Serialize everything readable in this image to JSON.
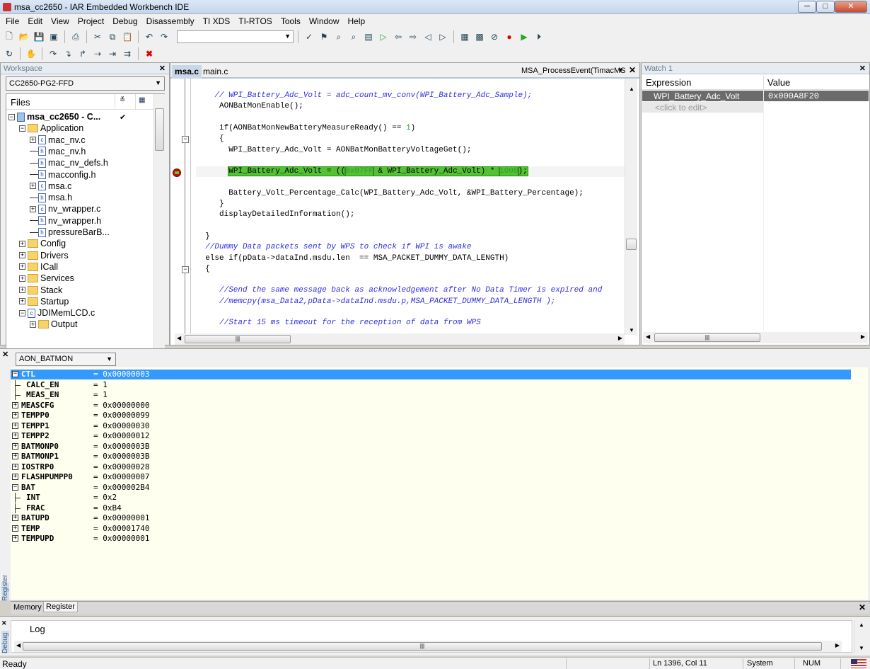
{
  "window": {
    "title": "msa_cc2650 - IAR Embedded Workbench IDE",
    "minimize": "─",
    "maximize": "□",
    "close": "✕"
  },
  "menu": [
    "File",
    "Edit",
    "View",
    "Project",
    "Debug",
    "Disassembly",
    "TI XDS",
    "TI-RTOS",
    "Tools",
    "Window",
    "Help"
  ],
  "toolbar1": {
    "icons": [
      "new-file-icon",
      "open-icon",
      "save-icon",
      "save-all-icon",
      "print-icon",
      "cut-icon",
      "copy-icon",
      "paste-icon",
      "undo-icon",
      "redo-icon"
    ],
    "search_value": "",
    "icons_right": [
      "check-icon",
      "bookmark-icon",
      "find-icon",
      "find-in-files-icon",
      "goto-icon",
      "next-bookmark-icon",
      "prev-icon",
      "next-icon",
      "nav-back-icon",
      "nav-forward-icon",
      "compile-icon",
      "make-icon",
      "stop-build-icon",
      "breakpoint-icon",
      "debug-icon",
      "download-debug-icon"
    ]
  },
  "toolbar2": {
    "icons": [
      "reset-icon",
      "break-icon",
      "step-over-icon",
      "step-into-icon",
      "step-out-icon",
      "next-statement-icon",
      "run-to-cursor-icon",
      "go-icon",
      "stop-debug-icon"
    ]
  },
  "workspace": {
    "title": "Workspace",
    "config": "CC2650-PG2-FFD",
    "files_header": "Files",
    "tree": [
      {
        "label": "msa_cc2650 - C...",
        "depth": 0,
        "type": "project",
        "exp": "-",
        "bold": true,
        "check": "✔"
      },
      {
        "label": "Application",
        "depth": 1,
        "type": "folder",
        "exp": "-"
      },
      {
        "label": "mac_nv.c",
        "depth": 2,
        "type": "c",
        "exp": "+"
      },
      {
        "label": "mac_nv.h",
        "depth": 2,
        "type": "h"
      },
      {
        "label": "mac_nv_defs.h",
        "depth": 2,
        "type": "h"
      },
      {
        "label": "macconfig.h",
        "depth": 2,
        "type": "h"
      },
      {
        "label": "msa.c",
        "depth": 2,
        "type": "c",
        "exp": "+"
      },
      {
        "label": "msa.h",
        "depth": 2,
        "type": "h"
      },
      {
        "label": "nv_wrapper.c",
        "depth": 2,
        "type": "c",
        "exp": "+"
      },
      {
        "label": "nv_wrapper.h",
        "depth": 2,
        "type": "h"
      },
      {
        "label": "pressureBarB...",
        "depth": 2,
        "type": "h"
      },
      {
        "label": "Config",
        "depth": 1,
        "type": "folder",
        "exp": "+"
      },
      {
        "label": "Drivers",
        "depth": 1,
        "type": "folder",
        "exp": "+"
      },
      {
        "label": "ICall",
        "depth": 1,
        "type": "folder",
        "exp": "+"
      },
      {
        "label": "Services",
        "depth": 1,
        "type": "folder",
        "exp": "+"
      },
      {
        "label": "Stack",
        "depth": 1,
        "type": "folder",
        "exp": "+"
      },
      {
        "label": "Startup",
        "depth": 1,
        "type": "folder",
        "exp": "+"
      },
      {
        "label": "JDIMemLCD.c",
        "depth": 1,
        "type": "c",
        "exp": "-"
      },
      {
        "label": "Output",
        "depth": 2,
        "type": "folder",
        "exp": "+"
      }
    ],
    "tabs": [
      "Overview",
      "msa_cc2650",
      "cc2650Stack"
    ]
  },
  "editor": {
    "tabs": [
      "msa.c",
      "main.c"
    ],
    "active_tab": "msa.c",
    "function_nav": "MSA_ProcessEvent(TimacMS",
    "lines": [
      [
        {
          "t": "    // WPI_Battery_Adc_Volt = adc_count_mv_conv(WPI_Battery_Adc_Sample);",
          "k": "cm"
        }
      ],
      [
        {
          "t": "     AONBatMonEnable();"
        }
      ],
      [],
      [
        {
          "t": "     if(AONBatMonNewBatteryMeasureReady() == "
        },
        {
          "t": "1",
          "k": "num"
        },
        {
          "t": ")"
        }
      ],
      [
        {
          "t": "     {"
        }
      ],
      [
        {
          "t": "       WPI_Battery_Adc_Volt = AONBatMonBatteryVoltageGet();"
        }
      ],
      [],
      [
        {
          "t": "       "
        },
        {
          "t": "WPI_Battery_Adc_Volt = ((",
          "k": "hl"
        },
        {
          "t": "0x07FF",
          "k": "hl num"
        },
        {
          "t": " & WPI_Battery_Adc_Volt) * ",
          "k": "hl"
        },
        {
          "t": "1000",
          "k": "hl num"
        },
        {
          "t": ");",
          "k": "hl"
        }
      ],
      [],
      [
        {
          "t": "       Battery_Volt_Percentage_Calc(WPI_Battery_Adc_Volt, &WPI_Battery_Percentage);"
        }
      ],
      [
        {
          "t": "     }"
        }
      ],
      [
        {
          "t": "     displayDetailedInformation();"
        }
      ],
      [],
      [
        {
          "t": "  }"
        }
      ],
      [
        {
          "t": "  //Dummy Data packets sent by WPS to check if WPI is awake",
          "k": "cm"
        }
      ],
      [
        {
          "t": "  else if(pData->dataInd.msdu.len  == MSA_PACKET_DUMMY_DATA_LENGTH)"
        }
      ],
      [
        {
          "t": "  {"
        }
      ],
      [],
      [
        {
          "t": "     //Send the same message back as acknowledgement after No Data Timer is expired and",
          "k": "cm"
        }
      ],
      [
        {
          "t": "     //memcpy(msa_Data2,pData->dataInd.msdu.p,MSA_PACKET_DUMMY_DATA_LENGTH );",
          "k": "cm"
        }
      ],
      [],
      [
        {
          "t": "     //Start 15 ms timeout for the reception of data from WPS",
          "k": "cm"
        }
      ]
    ]
  },
  "watch": {
    "title": "Watch 1",
    "col_expression": "Expression",
    "col_value": "Value",
    "rows": [
      {
        "expression": "WPI_Battery_Adc_Volt",
        "value": "0x000A8F20"
      }
    ],
    "placeholder": "<click to edit>"
  },
  "register": {
    "side_label": "Register",
    "group": "AON_BATMON",
    "rows": [
      {
        "name": "CTL",
        "value": "= 0x00000003",
        "exp": "-",
        "selected": true
      },
      {
        "name": "CALC_EN",
        "value": "= 1",
        "child": true
      },
      {
        "name": "MEAS_EN",
        "value": "= 1",
        "child": true
      },
      {
        "name": "MEASCFG",
        "value": "= 0x00000000",
        "exp": "+"
      },
      {
        "name": "TEMPP0",
        "value": "= 0x00000099",
        "exp": "+"
      },
      {
        "name": "TEMPP1",
        "value": "= 0x00000030",
        "exp": "+"
      },
      {
        "name": "TEMPP2",
        "value": "= 0x00000012",
        "exp": "+"
      },
      {
        "name": "BATMONP0",
        "value": "= 0x0000003B",
        "exp": "+"
      },
      {
        "name": "BATMONP1",
        "value": "= 0x0000003B",
        "exp": "+"
      },
      {
        "name": "IOSTRP0",
        "value": "= 0x00000028",
        "exp": "+"
      },
      {
        "name": "FLASHPUMPP0",
        "value": "= 0x00000007",
        "exp": "+"
      },
      {
        "name": "BAT",
        "value": "= 0x000002B4",
        "exp": "-"
      },
      {
        "name": "INT",
        "value": "= 0x2",
        "child": true
      },
      {
        "name": "FRAC",
        "value": "= 0xB4",
        "child": true
      },
      {
        "name": "BATUPD",
        "value": "= 0x00000001",
        "exp": "+"
      },
      {
        "name": "TEMP",
        "value": "= 0x00001740",
        "exp": "+"
      },
      {
        "name": "TEMPUPD",
        "value": "= 0x00000001",
        "exp": "+"
      }
    ],
    "tabs": [
      "Memory",
      "Register"
    ],
    "active_tab": "Register"
  },
  "debug_log": {
    "side_label": "Debug",
    "header": "Log"
  },
  "status": {
    "ready": "Ready",
    "position": "Ln 1396, Col 11",
    "encoding": "System",
    "num": "NUM"
  },
  "colors": {
    "selection": "#3399ff",
    "highlight": "#52c232",
    "comment": "#3030e0",
    "number": "#2aa02a",
    "register_bg": "#fffff0"
  }
}
